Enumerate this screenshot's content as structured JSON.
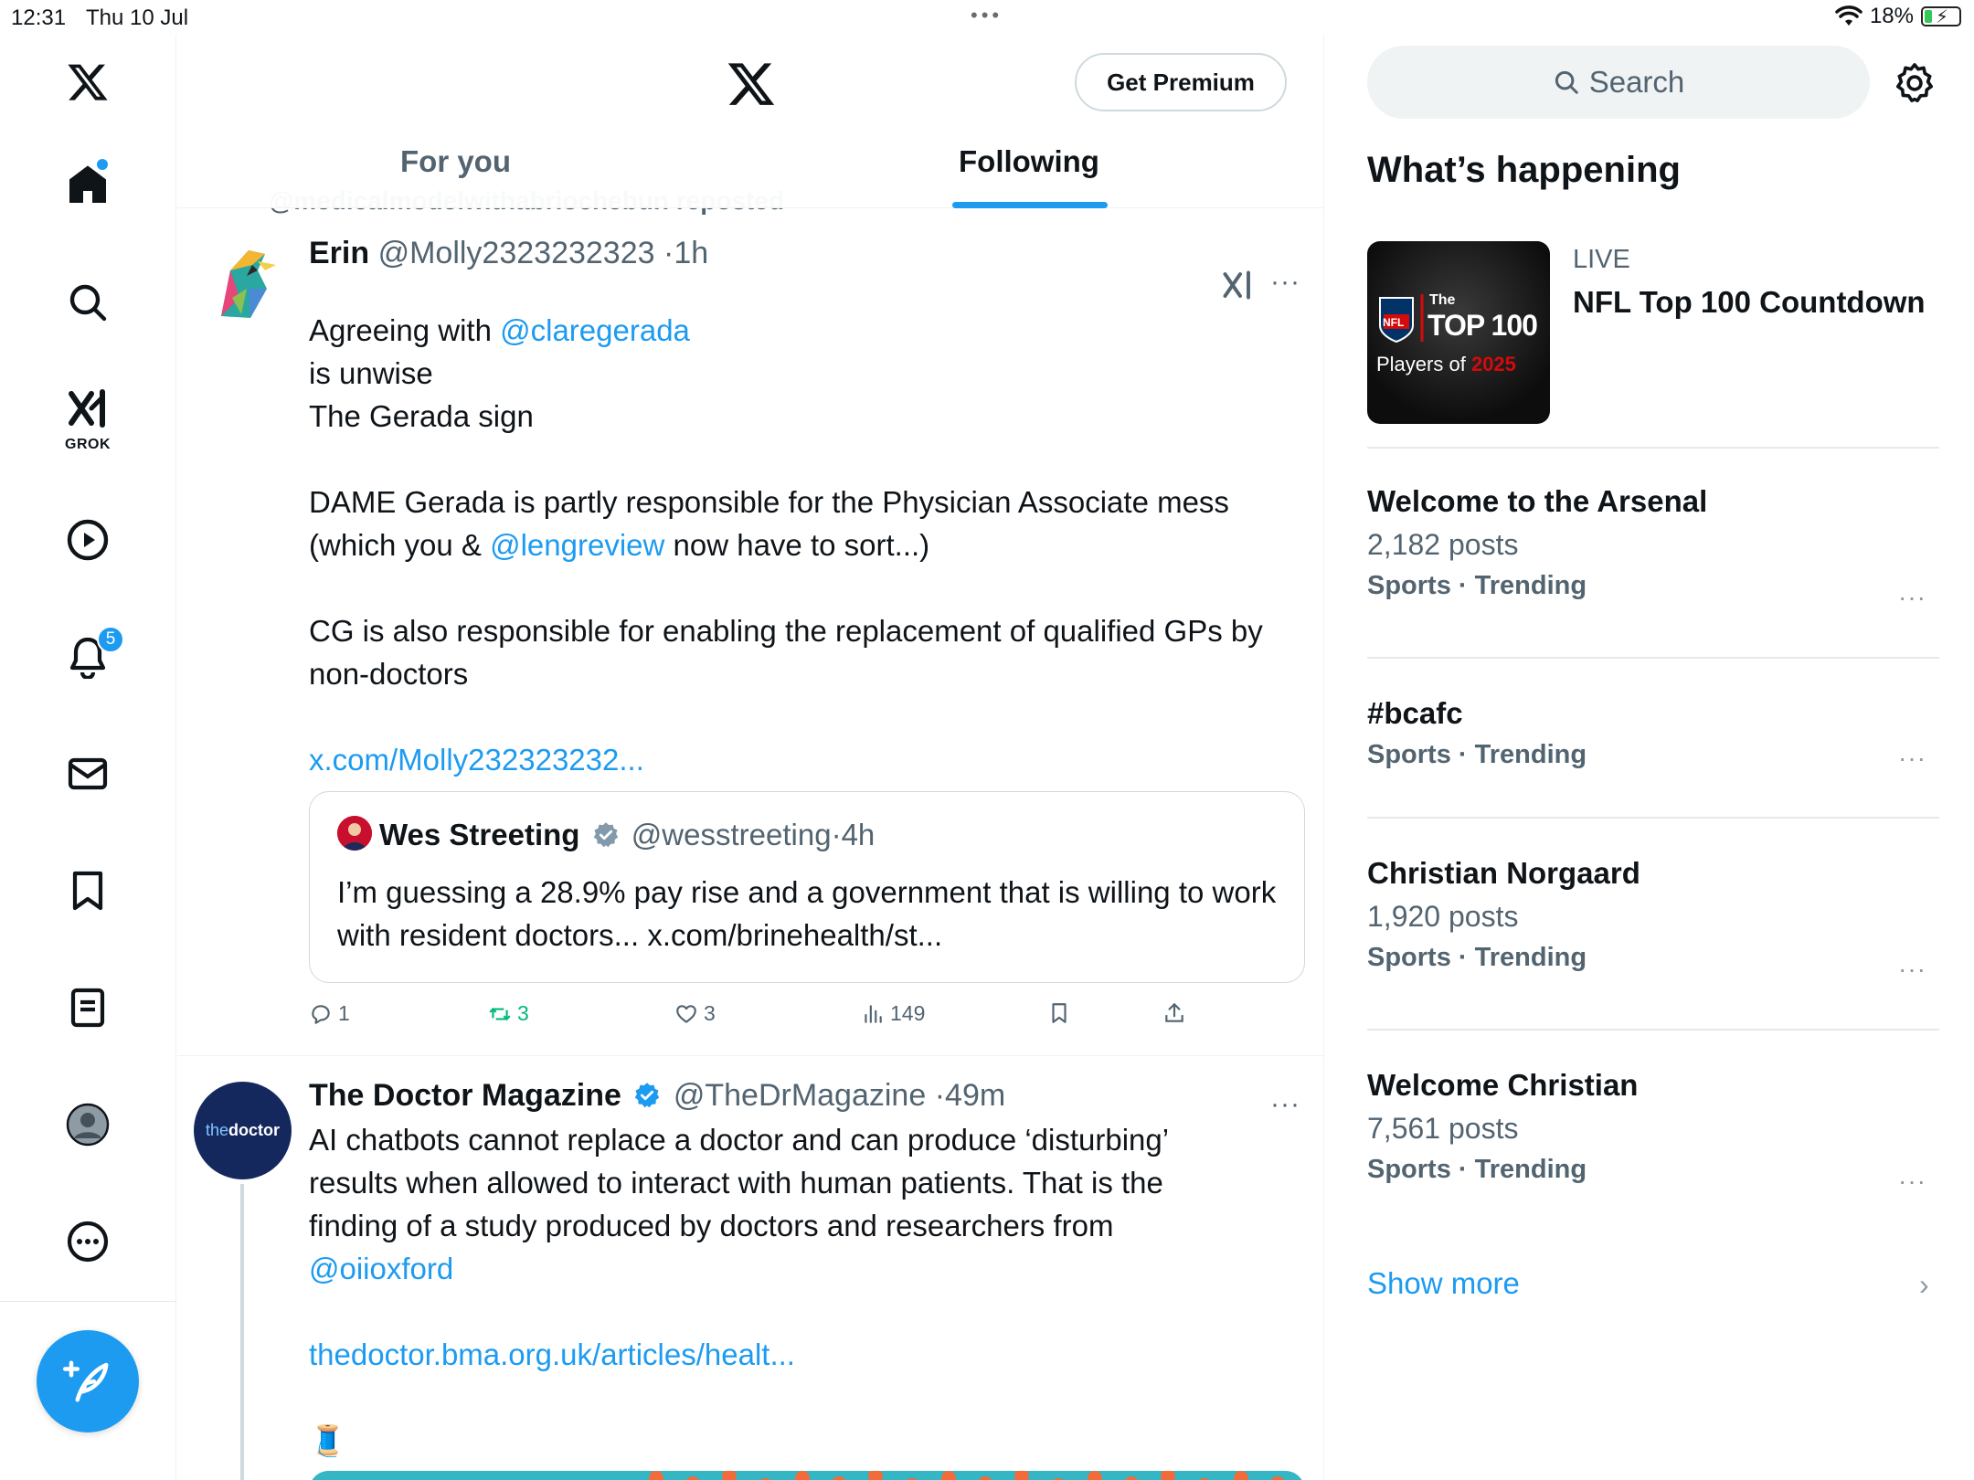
{
  "status_bar": {
    "time": "12:31",
    "date": "Thu 10 Jul",
    "battery": "18%"
  },
  "nav": {
    "notifications_badge": "5",
    "grok_label": "GROK"
  },
  "header": {
    "premium_label": "Get Premium",
    "tabs": [
      {
        "label": "For you",
        "active": false
      },
      {
        "label": "Following",
        "active": true
      }
    ]
  },
  "repost_line": "@medicalmodelwithabriochebun reposted",
  "tweets": [
    {
      "name": "Erin",
      "handle": "@Molly2323232323",
      "time": "1h",
      "body_parts": {
        "p1_a": "Agreeing with ",
        "p1_link": "@claregerada",
        "p1_b": "is unwise",
        "p1_c": "The Gerada sign",
        "p2_a": "DAME Gerada is partly responsible for the Physician Associate mess",
        "p2_b": "(which you & ",
        "p2_link": "@lengreview",
        "p2_c": " now have to sort...)",
        "p3": "CG is also responsible for enabling the replacement of qualified GPs by non-doctors",
        "url": "x.com/Molly232323232..."
      },
      "quote": {
        "name": "Wes Streeting",
        "handle": "@wesstreeting",
        "time": "4h",
        "text": "I’m guessing a 28.9% pay rise and a government that is willing to work with resident doctors... x.com/brinehealth/st..."
      },
      "stats": {
        "replies": "1",
        "reposts": "3",
        "likes": "3",
        "views": "149"
      }
    },
    {
      "name": "The Doctor Magazine",
      "handle": "@TheDrMagazine",
      "time": "49m",
      "avatar_text": "thedoctor",
      "avatar_text_a": "the",
      "avatar_text_b": "doctor",
      "body_a": "AI chatbots cannot replace a doctor and can produce ‘disturbing’ results when allowed to interact with human patients. That is the finding of a study produced by doctors and researchers from",
      "body_link": "@oiioxford",
      "url": "thedoctor.bma.org.uk/articles/healt...",
      "emoji": "🧵"
    }
  ],
  "sidebar": {
    "search_placeholder": "Search",
    "title": "What’s happening",
    "live": {
      "label": "LIVE",
      "title": "NFL Top 100 Countdown",
      "thumb_the": "The",
      "thumb_top": "TOP 100",
      "thumb_players": "Players of",
      "thumb_year": "2025",
      "thumb_nfl": "NFL"
    },
    "trends": [
      {
        "title": "Welcome to the Arsenal",
        "count": "2,182 posts",
        "category": "Sports · Trending"
      },
      {
        "title": "#bcafc",
        "count": "",
        "category": "Sports · Trending"
      },
      {
        "title": "Christian Norgaard",
        "count": "1,920 posts",
        "category": "Sports · Trending"
      },
      {
        "title": "Welcome Christian",
        "count": "7,561 posts",
        "category": "Sports · Trending"
      }
    ],
    "show_more": "Show more"
  },
  "colors": {
    "accent": "#1d9bf0",
    "repost_green": "#00ba7c",
    "muted": "#536471"
  }
}
